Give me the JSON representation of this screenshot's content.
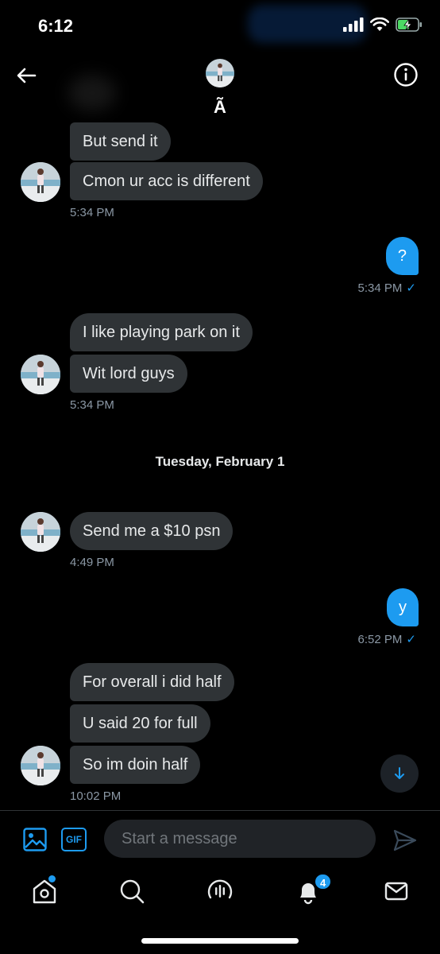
{
  "status_bar": {
    "time": "6:12"
  },
  "header": {
    "name": "Ã",
    "back_icon": "arrow-left-icon",
    "info_icon": "info-icon"
  },
  "messages": [
    {
      "dir": "in",
      "text": "But send it"
    },
    {
      "dir": "in",
      "text": "Cmon ur acc is different"
    },
    {
      "dir": "in_ts",
      "text": "5:34 PM"
    },
    {
      "dir": "out",
      "text": "?"
    },
    {
      "dir": "out_ts",
      "text": "5:34 PM"
    },
    {
      "dir": "in",
      "text": "I like playing park on it"
    },
    {
      "dir": "in",
      "text": "Wit lord guys"
    },
    {
      "dir": "in_ts",
      "text": "5:34 PM"
    },
    {
      "dir": "date",
      "text": "Tuesday, February 1"
    },
    {
      "dir": "in",
      "text": "Send me a $10 psn"
    },
    {
      "dir": "in_ts",
      "text": "4:49 PM"
    },
    {
      "dir": "out",
      "text": "y"
    },
    {
      "dir": "out_ts",
      "text": "6:52 PM"
    },
    {
      "dir": "in",
      "text": "For overall i did half"
    },
    {
      "dir": "in",
      "text": "U said 20 for full"
    },
    {
      "dir": "in",
      "text": "So im doin half"
    },
    {
      "dir": "in_ts",
      "text": "10:02 PM"
    }
  ],
  "composer": {
    "placeholder": "Start a message",
    "gif_label": "GIF"
  },
  "tabbar": {
    "notifications_badge": "4"
  },
  "colors": {
    "accent": "#1d9bf0",
    "bubble_in": "#2f3336",
    "background": "#000000"
  }
}
